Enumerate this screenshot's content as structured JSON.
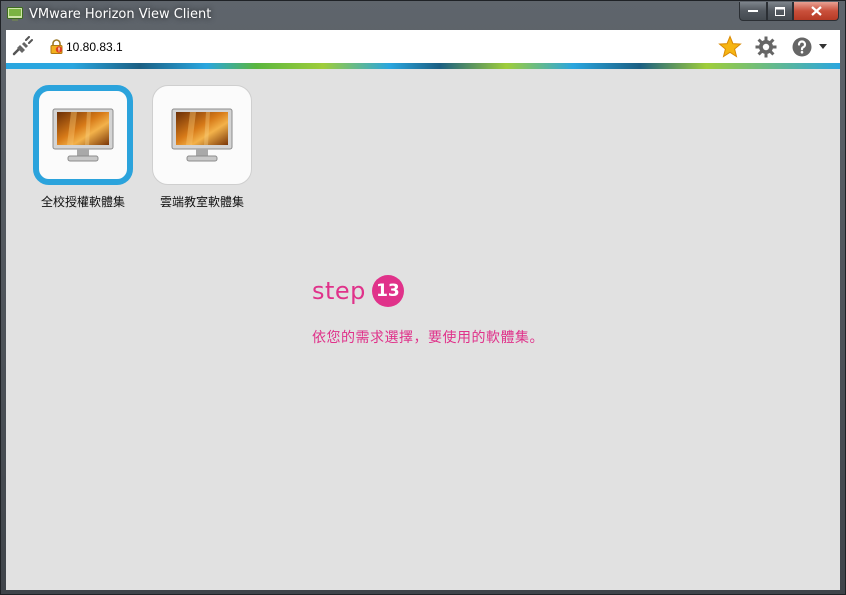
{
  "window": {
    "title": "VMware Horizon View Client"
  },
  "toolbar": {
    "server_address": "10.80.83.1",
    "icons": [
      "plug-icon",
      "lock-icon",
      "star-icon",
      "gear-icon",
      "help-icon",
      "chevron-down-icon"
    ]
  },
  "desktops": [
    {
      "label": "全校授權軟體集",
      "selected": true
    },
    {
      "label": "雲端教室軟體集",
      "selected": false
    }
  ],
  "overlay": {
    "step_word": "step",
    "step_number": "13",
    "instruction": "依您的需求選擇，要使用的軟體集。"
  },
  "colors": {
    "accent_pink": "#e0328a",
    "selection_blue": "#2ba3dc",
    "content_bg": "#e1e1e1"
  }
}
